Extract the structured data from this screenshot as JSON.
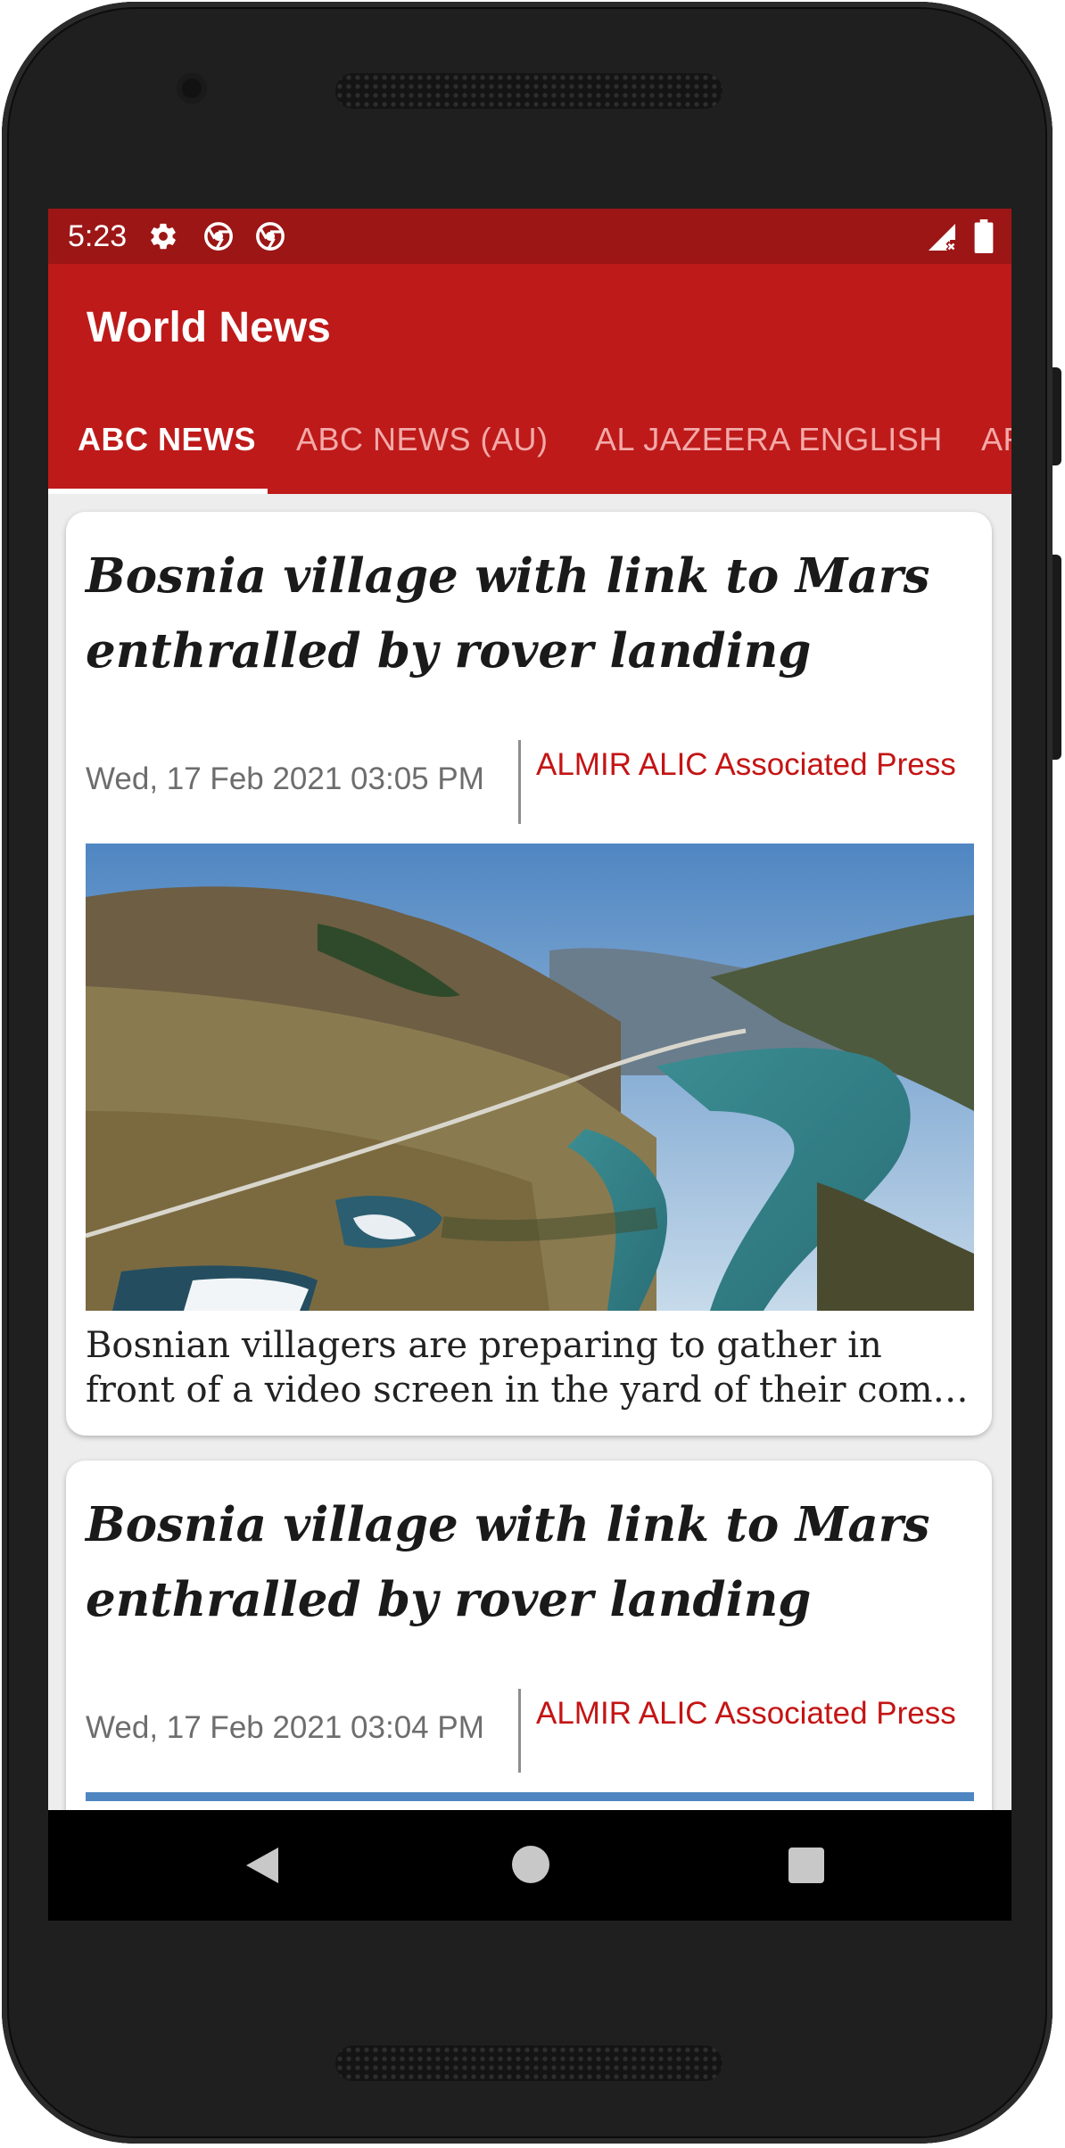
{
  "status_bar": {
    "time": "5:23",
    "icons": [
      "gear-icon",
      "chrome-icon",
      "chrome-icon",
      "signal-icon",
      "battery-icon"
    ]
  },
  "app_bar": {
    "title": "World News"
  },
  "tabs": [
    {
      "label": "ABC NEWS",
      "active": true
    },
    {
      "label": "ABC NEWS (AU)",
      "active": false
    },
    {
      "label": "AL JAZEERA ENGLISH",
      "active": false
    },
    {
      "label": "AR",
      "active": false
    }
  ],
  "articles": [
    {
      "title": "Bosnia village with link to Mars enthralled by rover landing",
      "date": "Wed, 17 Feb 2021 03:05 PM",
      "source": "ALMIR ALIC Associated Press",
      "image": "aerial-river-valley-photo",
      "description": "Bosnian villagers are preparing to gather in front of a video screen in the yard of their com…"
    },
    {
      "title": "Bosnia village with link to Mars enthralled by rover landing",
      "date": "Wed, 17 Feb 2021 03:04 PM",
      "source": "ALMIR ALIC Associated Press"
    }
  ],
  "nav_bar": {
    "icons": [
      "back-icon",
      "home-icon",
      "recents-icon"
    ]
  },
  "colors": {
    "primary": "#be1a1a",
    "primary_dark": "#9c1616",
    "accent_text": "#c41414",
    "tab_inactive": "#f3aaa8"
  }
}
